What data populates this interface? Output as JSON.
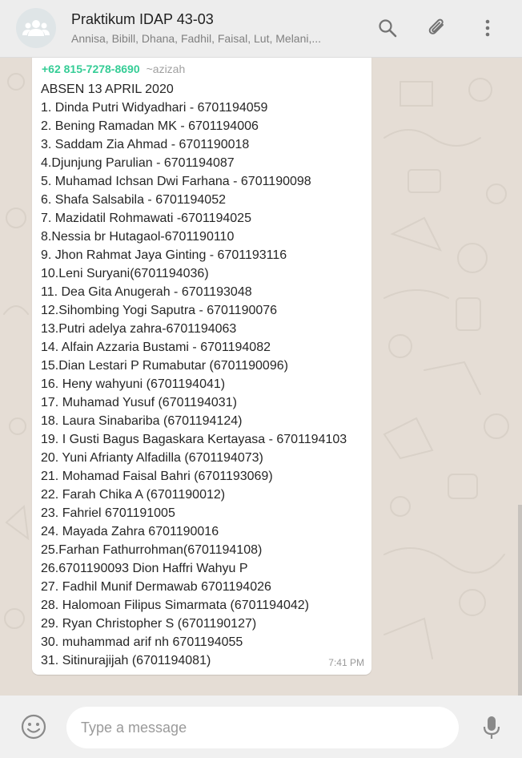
{
  "header": {
    "title": "Praktikum IDAP 43-03",
    "subtitle": "Annisa, Bibill, Dhana, Fadhil, Faisal, Lut, Melani,..."
  },
  "message": {
    "sender_phone": "+62 815-7278-8690",
    "sender_name": "~azizah",
    "lines": [
      "ABSEN 13 APRIL 2020",
      "1. Dinda Putri Widyadhari - 6701194059",
      "2. Bening Ramadan MK - 6701194006",
      "3. Saddam Zia Ahmad - 6701190018",
      "4.Djunjung Parulian - 6701194087",
      "5. Muhamad Ichsan Dwi Farhana - 6701190098",
      "6. Shafa Salsabila - 6701194052",
      "7. Mazidatil Rohmawati -6701194025",
      "8.Nessia br Hutagaol-6701190110",
      "9. Jhon Rahmat Jaya Ginting - 6701193116",
      "10.Leni Suryani(6701194036)",
      "11. Dea Gita Anugerah - 6701193048",
      "12.Sihombing Yogi Saputra - 6701190076",
      "13.Putri adelya zahra-6701194063",
      "14. Alfain Azzaria Bustami - 6701194082",
      "15.Dian Lestari P Rumabutar (6701190096)",
      "16. Heny wahyuni (6701194041)",
      "17. Muhamad Yusuf (6701194031)",
      "18. Laura Sinabariba (6701194124)",
      "19. I Gusti Bagus Bagaskara Kertayasa - 6701194103",
      "20. Yuni Afrianty Alfadilla (6701194073)",
      "21. Mohamad Faisal Bahri (6701193069)",
      "22. Farah Chika A (6701190012)",
      "23. Fahriel 6701191005",
      "24. Mayada Zahra 6701190016",
      "25.Farhan Fathurrohman(6701194108)",
      "26.6701190093 Dion Haffri Wahyu P",
      "27. Fadhil Munif Dermawab 6701194026",
      "28. Halomoan Filipus Simarmata (6701194042)",
      "29. Ryan Christopher S (6701190127)",
      "30. muhammad arif nh 6701194055",
      "31. Sitinurajijah (6701194081)"
    ],
    "time": "7:41 PM"
  },
  "composer": {
    "placeholder": "Type a message"
  },
  "icons": {
    "avatar": "group-avatar-icon",
    "search": "search-icon",
    "attach": "paperclip-icon",
    "menu": "more-vertical-icon",
    "emoji": "emoji-icon",
    "mic": "microphone-icon"
  },
  "colors": {
    "sender_phone": "#35cd96",
    "chat_background": "#e5ddd5",
    "header_background": "#ededed"
  }
}
